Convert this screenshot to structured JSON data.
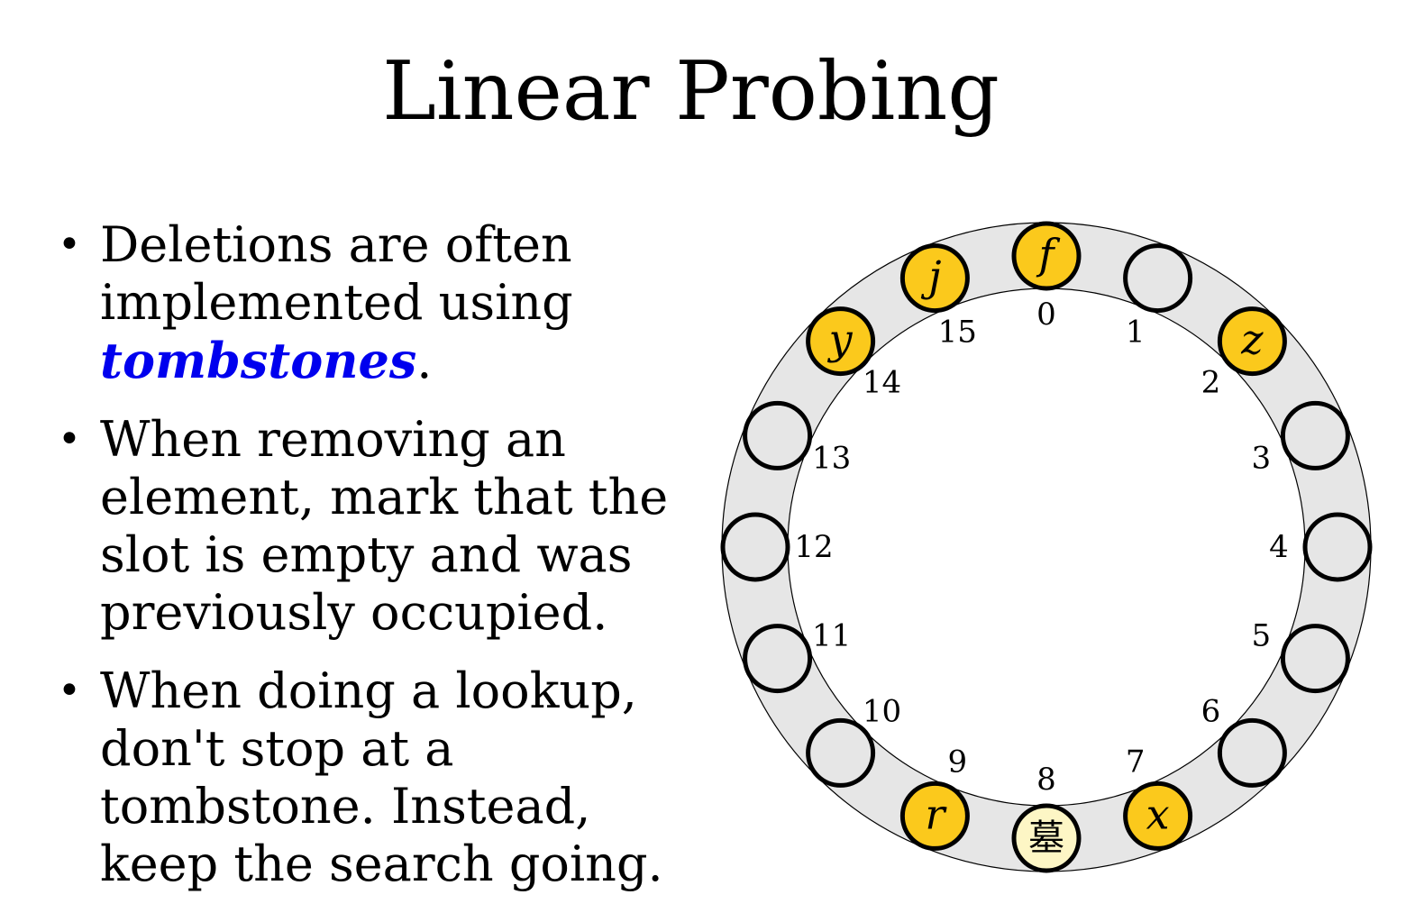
{
  "title": "Linear Probing",
  "bullets": [
    {
      "before": "Deletions are often implemented using ",
      "emph": "tombstones",
      "after": "."
    },
    {
      "before": "When removing an element, mark that the slot is empty and was previously occupied.",
      "emph": "",
      "after": ""
    },
    {
      "before": "When doing a lookup, don't stop at a tombstone. Instead, keep the search going.",
      "emph": "",
      "after": ""
    }
  ],
  "colors": {
    "ring": "#e6e6e6",
    "occupied": "#fbc91c",
    "empty": "#e6e6e6",
    "tombstone": "#fdf6c5",
    "emphasis": "#0000ee"
  },
  "table": {
    "slots": [
      {
        "index": "0",
        "key": "f",
        "state": "occupied"
      },
      {
        "index": "1",
        "key": "",
        "state": "empty"
      },
      {
        "index": "2",
        "key": "z",
        "state": "occupied"
      },
      {
        "index": "3",
        "key": "",
        "state": "empty"
      },
      {
        "index": "4",
        "key": "",
        "state": "empty"
      },
      {
        "index": "5",
        "key": "",
        "state": "empty"
      },
      {
        "index": "6",
        "key": "",
        "state": "empty"
      },
      {
        "index": "7",
        "key": "x",
        "state": "occupied"
      },
      {
        "index": "8",
        "key": "墓",
        "state": "tombstone"
      },
      {
        "index": "9",
        "key": "r",
        "state": "occupied"
      },
      {
        "index": "10",
        "key": "",
        "state": "empty"
      },
      {
        "index": "11",
        "key": "",
        "state": "empty"
      },
      {
        "index": "12",
        "key": "",
        "state": "empty"
      },
      {
        "index": "13",
        "key": "",
        "state": "empty"
      },
      {
        "index": "14",
        "key": "y",
        "state": "occupied"
      },
      {
        "index": "15",
        "key": "j",
        "state": "occupied"
      }
    ]
  }
}
